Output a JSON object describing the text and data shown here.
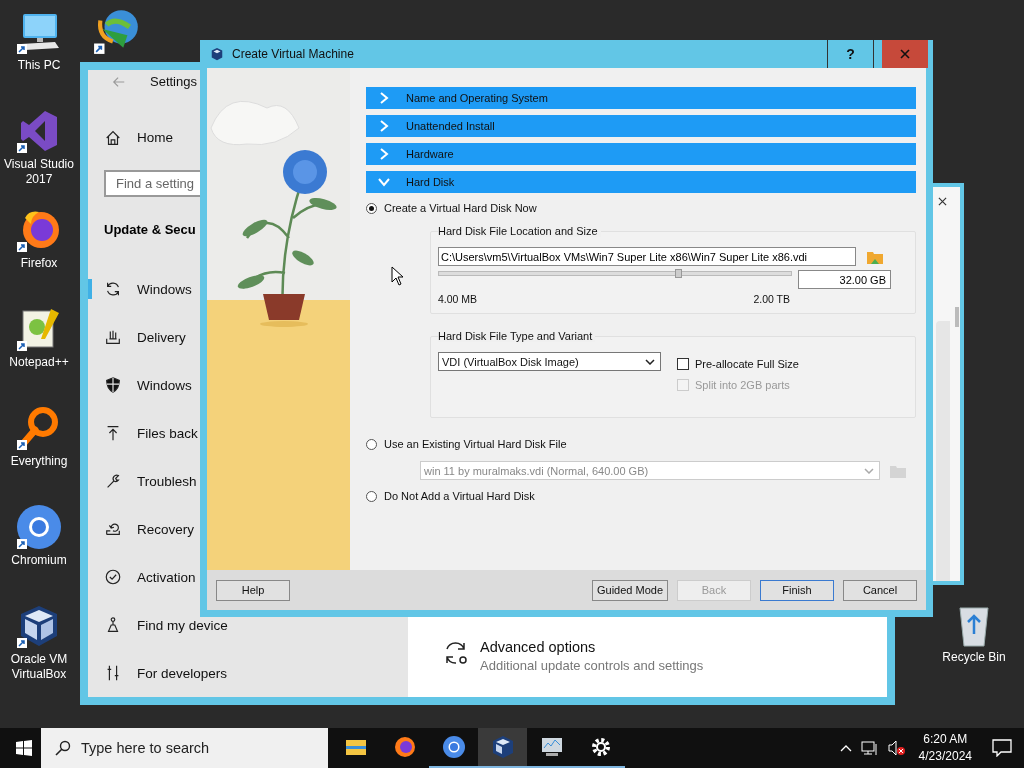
{
  "desktop_icons": [
    {
      "label": "This PC",
      "kind": "pc"
    },
    {
      "label": "Visual Studio 2017",
      "kind": "vs"
    },
    {
      "label": "Firefox",
      "kind": "firefox"
    },
    {
      "label": "Notepad++",
      "kind": "notepad"
    },
    {
      "label": "Everything",
      "kind": "everything"
    },
    {
      "label": "Chromium",
      "kind": "chromium"
    },
    {
      "label": "Oracle VM VirtualBox",
      "kind": "virtualbox"
    }
  ],
  "recycle_bin": {
    "label": "Recycle Bin"
  },
  "settings_window": {
    "title": "Settings",
    "home": "Home",
    "search": {
      "placeholder": "Find a setting"
    },
    "heading": "Update & Secu",
    "items": [
      {
        "label": "Windows",
        "kind": "sync",
        "selected": true
      },
      {
        "label": "Delivery",
        "kind": "delivery",
        "selected": false
      },
      {
        "label": "Windows",
        "kind": "shield",
        "selected": false
      },
      {
        "label": "Files back",
        "kind": "backup",
        "selected": false
      },
      {
        "label": "Troublesh",
        "kind": "wrench",
        "selected": false
      },
      {
        "label": "Recovery",
        "kind": "recovery",
        "selected": false
      },
      {
        "label": "Activation",
        "kind": "activation",
        "selected": false
      },
      {
        "label": "Find my device",
        "kind": "find",
        "selected": false
      },
      {
        "label": "For developers",
        "kind": "developers",
        "selected": false
      }
    ],
    "content": {
      "title": "Advanced options",
      "subtitle": "Additional update controls and settings"
    }
  },
  "dialog": {
    "title": "Create Virtual Machine",
    "help_glyph": "?",
    "sections": [
      {
        "title": "Name and Operating System",
        "expanded": false
      },
      {
        "title": "Unattended Install",
        "expanded": false
      },
      {
        "title": "Hardware",
        "expanded": false
      },
      {
        "title": "Hard Disk",
        "expanded": true
      }
    ],
    "disk_options": [
      {
        "label": "Create a Virtual Hard Disk Now",
        "selected": true
      },
      {
        "label": "Use an Existing Virtual Hard Disk File",
        "selected": false
      },
      {
        "label": "Do Not Add a Virtual Hard Disk",
        "selected": false
      }
    ],
    "location": {
      "title": "Hard Disk File Location and Size",
      "path": "C:\\Users\\vm5\\VirtualBox VMs\\Win7 Super Lite x86\\Win7 Super Lite x86.vdi",
      "level": 0.68,
      "size": "32.00 GB",
      "min_label": "4.00 MB",
      "max_label": "2.00 TB"
    },
    "type_group": {
      "title": "Hard Disk File Type and Variant",
      "format": "VDI (VirtualBox Disk Image)",
      "checkboxes": [
        {
          "label": "Pre-allocate Full Size",
          "checked": false,
          "disabled": false
        },
        {
          "label": "Split into 2GB parts",
          "checked": false,
          "disabled": true
        }
      ]
    },
    "existing_disk": {
      "value": "win 11 by muralmaks.vdi (Normal, 640.00 GB)",
      "disabled": true
    },
    "help_button": "Help",
    "buttons": [
      {
        "label": "Guided Mode",
        "disabled": false,
        "default": false
      },
      {
        "label": "Back",
        "disabled": true,
        "default": false
      },
      {
        "label": "Finish",
        "disabled": false,
        "default": true
      },
      {
        "label": "Cancel",
        "disabled": false,
        "default": false
      }
    ]
  },
  "taskbar": {
    "search": {
      "placeholder": "Type here to search"
    },
    "apps": [
      {
        "kind": "explorer",
        "running": false,
        "active": false
      },
      {
        "kind": "firefox",
        "running": false,
        "active": false
      },
      {
        "kind": "chromium",
        "running": true,
        "active": false
      },
      {
        "kind": "virtualbox",
        "running": true,
        "active": true
      },
      {
        "kind": "monitor",
        "running": true,
        "active": false
      },
      {
        "kind": "settings",
        "running": true,
        "active": false
      }
    ],
    "time": "6:20 AM",
    "date": "4/23/2024"
  }
}
